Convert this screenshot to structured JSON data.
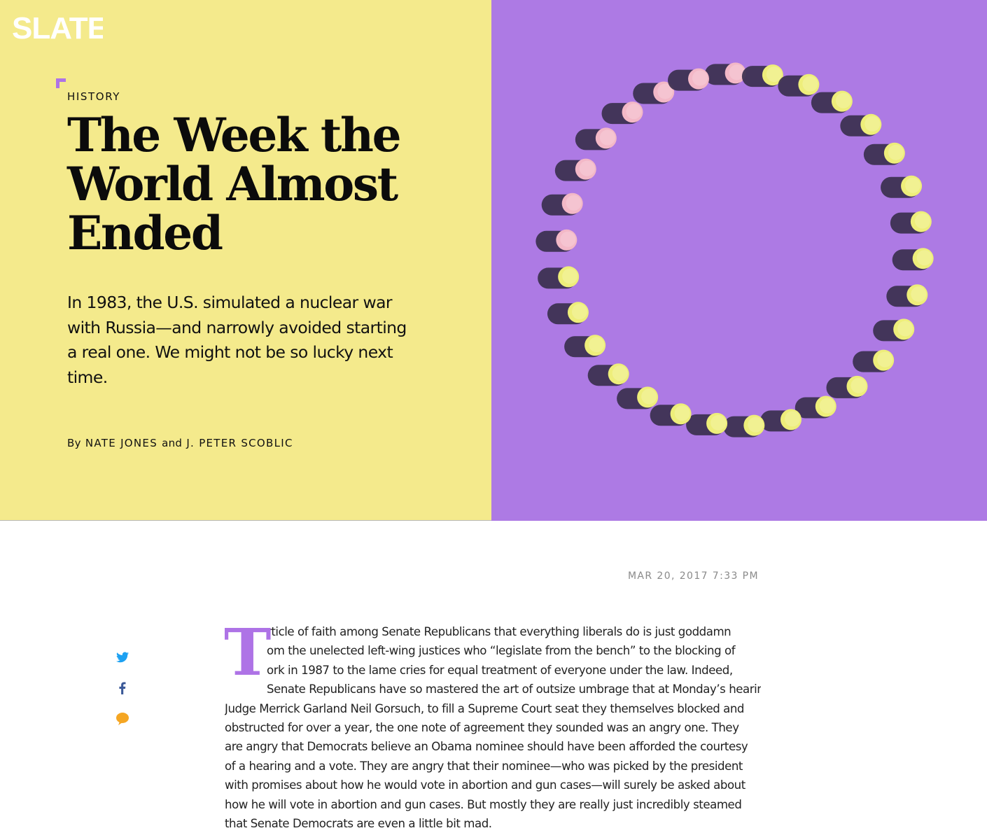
{
  "brand": {
    "logo_text": "SLATE"
  },
  "article": {
    "kicker": "HISTORY",
    "headline": "The Week the World Almost Ended",
    "dek": "In 1983, the U.S. simulated a nuclear war with Russia—and narrowly avoided starting a real one. We might not be so lucky next time.",
    "byline": {
      "prefix": "By",
      "author_1": "NATE JONES",
      "conjunction": "and",
      "author_2": "J. PETER SCOBLIC"
    },
    "date": "MAR 20, 2017 7:33 PM",
    "dropcap": "T",
    "body_lines": [
      "rticle of faith among Senate Republicans that everything liberals do is just goddamn",
      "om the unelected left-wing justices who “legislate from the bench” to the blocking of",
      "ork in 1987 to the lame cries for equal treatment of everyone under the law. Indeed,",
      "Senate Republicans have so mastered the art of outsize umbrage that at Monday’s hearing for",
      "Judge Merrick Garland Neil Gorsuch, to fill a Supreme Court seat they themselves blocked and",
      "obstructed for over a year, the one note of agreement they sounded was an angry one. They",
      "are angry that Democrats believe an Obama nominee should have been afforded the courtesy",
      "of a hearing and a vote. They are angry that their nominee—who was picked by the president",
      "with promises about how he would vote in abortion and gun cases—will surely be asked about",
      "how he will vote in abortion and gun cases. But mostly they are really just incredibly steamed",
      "that Senate Democrats are even a little bit mad."
    ]
  },
  "share": {
    "twitter_icon": "twitter-icon",
    "facebook_icon": "facebook-icon",
    "comment_icon": "comment-bubble-icon"
  },
  "colors": {
    "hero_left_bg": "#f4ea8c",
    "hero_right_bg": "#ad7ae4",
    "accent_purple": "#ae73e6",
    "pill_yellow": "#eeee7a",
    "pill_pink": "#f3b8c7",
    "pill_shadow": "#3a2f4e",
    "twitter_blue": "#1da1f2",
    "facebook_blue": "#3b5998",
    "comment_orange": "#f5a623",
    "date_gray": "#8a8a8a"
  }
}
